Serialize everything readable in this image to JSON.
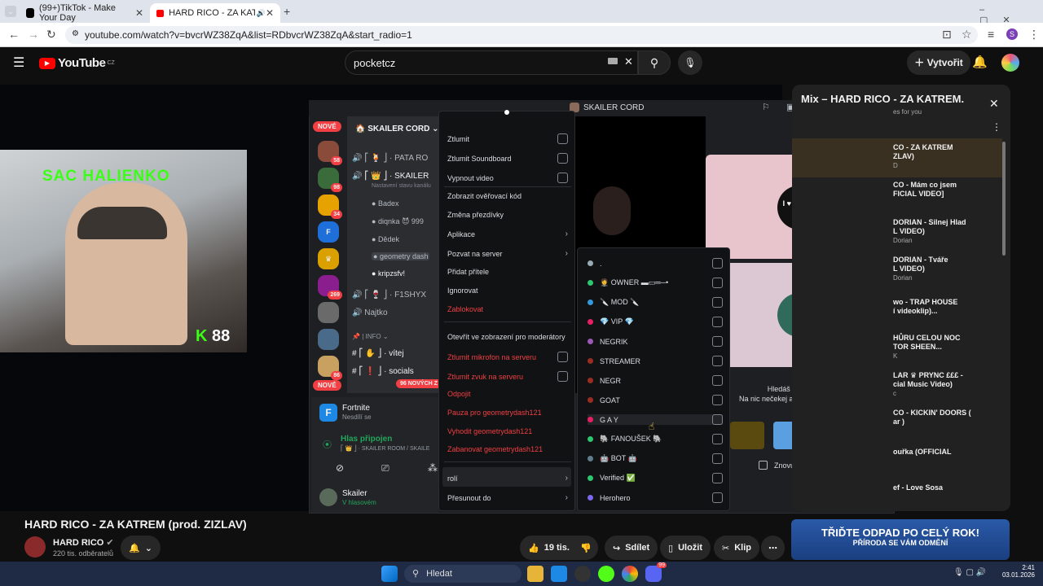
{
  "browser": {
    "tabs": [
      {
        "title": "(99+)TikTok - Make Your Day"
      },
      {
        "title": "HARD RICO - ZA KATREM ("
      }
    ],
    "url": "youtube.com/watch?v=bvcrWZ38ZqA&list=RDbvcrWZ38ZqA&start_radio=1"
  },
  "youtube": {
    "logo": "YouTube",
    "region": "CZ",
    "search_value": "pocketcz",
    "create_label": "Vytvořit",
    "video_title": "HARD RICO - ZA KATREM (prod. ZIZLAV)",
    "channel": "HARD RICO",
    "subscribers": "220 tis. odběratelů",
    "likes": "19 tis.",
    "share": "Sdílet",
    "save": "Uložit",
    "clip": "Klip",
    "playlist_title": "Mix – HARD RICO - ZA KATREM...",
    "playlist_sub": "es for you",
    "playlist_items": [
      {
        "title": "CO - ZA KATREM",
        "sub": "ZLAV)",
        "meta": "D"
      },
      {
        "title": "CO - Mám co jsem",
        "sub": "FICIAL VIDEO]",
        "meta": ""
      },
      {
        "title": "DORIAN - Silnej Hlad",
        "sub": "L VIDEO)",
        "meta": "Dorian"
      },
      {
        "title": "DORIAN - Tváře",
        "sub": "L VIDEO)",
        "meta": "Dorian"
      },
      {
        "title": "wo - TRAP HOUSE",
        "sub": "í videoklip)...",
        "meta": ""
      },
      {
        "title": "HŮRU CELOU NOC",
        "sub": "TOR SHEEN...",
        "meta": "K"
      },
      {
        "title": "LAR ♛ PRYNC £££ -",
        "sub": "cial Music Video)",
        "meta": "c"
      },
      {
        "title": "CO - KICKIN' DOORS (",
        "sub": "ar )",
        "meta": ""
      },
      {
        "title": "ouřka (OFFICIAL",
        "sub": "",
        "meta": ""
      },
      {
        "title": "ef - Love Sosa",
        "sub": "",
        "meta": ""
      }
    ],
    "ad_line1": "TŘIĎTE ODPAD PO CELÝ ROK!",
    "ad_line2": "PŘÍRODA SE VÁM ODMĚNÍ"
  },
  "webcam": {
    "overlay_text": "SAC HALIENKO",
    "counter": "88"
  },
  "discord": {
    "window_title": "SKAILER CORD",
    "new_badge": "NOVÉ",
    "server_name": "SKAILER CORD",
    "server_badges": [
      "58",
      "98",
      "34",
      "",
      "",
      "269",
      "",
      "",
      "86",
      "12"
    ],
    "channels": [
      {
        "text": "⎡ 🍹 ⎦ · PATA RO"
      },
      {
        "text": "⎡ 👑 ⎦ · SKAILER"
      },
      {
        "text": "Nastavení stavu kanálu"
      },
      {
        "text": "Badex"
      },
      {
        "text": "diqnka 😈 999"
      },
      {
        "text": "Dědek"
      },
      {
        "text": "geometry dash"
      },
      {
        "text": "kripzsfv!"
      },
      {
        "text": "⎡ 🍷 ⎦ · F1SHYX"
      },
      {
        "text": "Najtko"
      },
      {
        "text": "| INFO"
      },
      {
        "text": "⎡ ✋ ⎦ · vítej"
      },
      {
        "text": "⎡ ❗ ⎦ · socials"
      }
    ],
    "new_messages": "96 NOVÝCH Z",
    "activity_title": "Fortnite",
    "activity_sub": "Nesdílí se",
    "voice_status": "Hlas připojen",
    "voice_channel": "⎡ 👑 ⎦ · SKAILER ROOM / SKAILE",
    "user_name": "Skailer",
    "user_status": "V hlasovém",
    "context_menu": [
      {
        "label": "Ztlumit",
        "type": "check",
        "red": false
      },
      {
        "label": "Ztlumit Soundboard",
        "type": "check",
        "red": false
      },
      {
        "label": "Vypnout video",
        "type": "check",
        "red": false
      },
      {
        "label": "Zobrazit ověřovací kód",
        "type": "plain",
        "red": false
      },
      {
        "label": "Změna přezdívky",
        "type": "plain",
        "red": false
      },
      {
        "label": "Aplikace",
        "type": "arrow",
        "red": false
      },
      {
        "label": "Pozvat na server",
        "type": "arrow",
        "red": false
      },
      {
        "label": "Přidat přítele",
        "type": "plain",
        "red": false
      },
      {
        "label": "Ignorovat",
        "type": "plain",
        "red": false
      },
      {
        "label": "Zablokovat",
        "type": "plain",
        "red": true
      },
      {
        "label": "Otevřít ve zobrazení pro moderátory",
        "type": "plain",
        "red": false
      },
      {
        "label": "Ztlumit mikrofon na serveru",
        "type": "check",
        "red": true
      },
      {
        "label": "Ztlumit zvuk na serveru",
        "type": "check",
        "red": true
      },
      {
        "label": "Odpojit",
        "type": "plain",
        "red": true
      },
      {
        "label": "Pauza pro geometrydash121",
        "type": "plain",
        "red": true
      },
      {
        "label": "Vyhodit geometrydash121",
        "type": "plain",
        "red": true
      },
      {
        "label": "Zabanovat geometrydash121",
        "type": "plain",
        "red": true
      },
      {
        "label": "rolí",
        "type": "arrow",
        "red": false
      },
      {
        "label": "Přesunout do",
        "type": "arrow",
        "red": false
      }
    ],
    "roles": [
      {
        "label": ".",
        "color": "#99aab5"
      },
      {
        "label": "🤵 OWNER ▬▭═─•",
        "color": "#2dc770"
      },
      {
        "label": "🔪 MOD 🔪",
        "color": "#3498db"
      },
      {
        "label": "💎 VIP 💎",
        "color": "#e91e63"
      },
      {
        "label": "NEGRIK",
        "color": "#9b59b6"
      },
      {
        "label": "STREAMER",
        "color": "#992d22"
      },
      {
        "label": "NEGR",
        "color": "#992d22"
      },
      {
        "label": "GOAT",
        "color": "#992d22"
      },
      {
        "label": "G A Y",
        "color": "#e91e63"
      },
      {
        "label": "🐘 FANOUŠEK 🐘",
        "color": "#2dc770"
      },
      {
        "label": "🤖 BOT 🤖",
        "color": "#607d8b"
      },
      {
        "label": "Verified ✅",
        "color": "#2dc770"
      },
      {
        "label": "Herohero",
        "color": "#7b68ee"
      }
    ],
    "tile_text": "I ♥ MY BF",
    "game_prompt_1": "Hledáš nějakou zábavu?",
    "game_prompt_2": "Na nic nečekej a pusť si nějakou hru nebo videa.",
    "dont_show": "Znovu nezobrazovat"
  },
  "taskbar": {
    "search": "Hledat",
    "time": "2:41",
    "date": "03.01.2026",
    "discord_badge": "99"
  }
}
